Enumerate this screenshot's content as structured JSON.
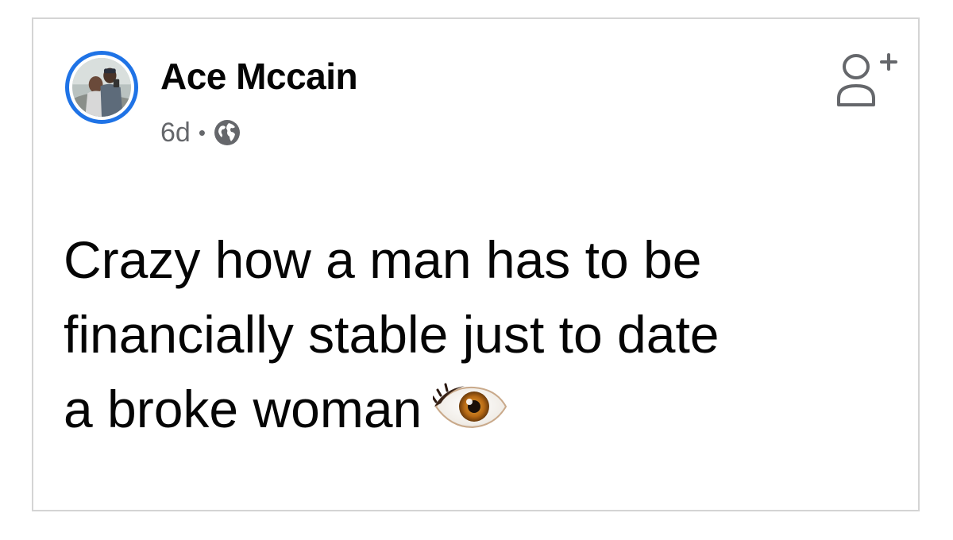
{
  "post": {
    "author_name": "Ace Mccain",
    "timestamp": "6d",
    "separator": "•",
    "privacy_icon": "globe-icon",
    "follow_icon": "add-friend-icon",
    "text_lines": [
      "Crazy how a man has to be",
      "financially stable just to date",
      "a broke woman"
    ],
    "emoji": "eye-emoji"
  },
  "colors": {
    "avatar_ring": "#1f73e6",
    "name_text": "#050505",
    "meta_text": "#65676b",
    "card_border": "#d4d4d4"
  }
}
